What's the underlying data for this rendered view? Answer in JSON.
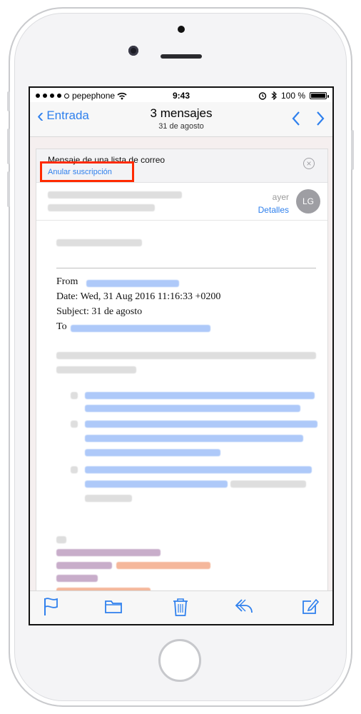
{
  "status_bar": {
    "carrier": "pepephone",
    "time": "9:43",
    "battery": "100 %",
    "battery_level": 1.0
  },
  "nav": {
    "back_label": "Entrada",
    "title": "3 mensajes",
    "subtitle": "31 de agosto"
  },
  "list_banner": {
    "text": "Mensaje de una lista de correo",
    "unsubscribe": "Anular suscripción"
  },
  "sender": {
    "time": "ayer",
    "details": "Detalles",
    "avatar": "LG"
  },
  "message_meta": {
    "from": "From",
    "date": "Date: Wed, 31 Aug 2016 11:16:33 +0200",
    "subject": "Subject: 31 de agosto",
    "to": "To"
  },
  "icons": {
    "flag": "flag-icon",
    "folder": "folder-icon",
    "trash": "trash-icon",
    "reply": "reply-icon",
    "compose": "compose-icon"
  },
  "colors": {
    "accent": "#2f80ed",
    "highlight": "#ff2a00"
  }
}
